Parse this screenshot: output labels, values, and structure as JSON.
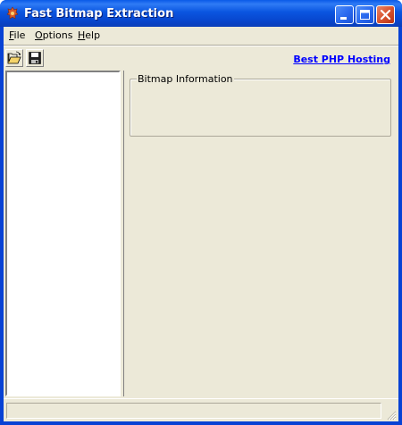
{
  "window": {
    "title": "Fast Bitmap Extraction",
    "icon": "app-icon"
  },
  "menu": {
    "file": {
      "label": "File",
      "accel": "F"
    },
    "options": {
      "label": "Options",
      "accel": "O"
    },
    "help": {
      "label": "Help",
      "accel": "H"
    }
  },
  "toolbar": {
    "open_icon": "folder-open-icon",
    "save_icon": "floppy-disk-icon",
    "link_text": "Best PHP Hosting"
  },
  "group": {
    "label": "Bitmap Information"
  },
  "colors": {
    "titlebar": "#0a55e0",
    "face": "#ece9d8",
    "link": "#0000ff",
    "close": "#d9542f"
  }
}
